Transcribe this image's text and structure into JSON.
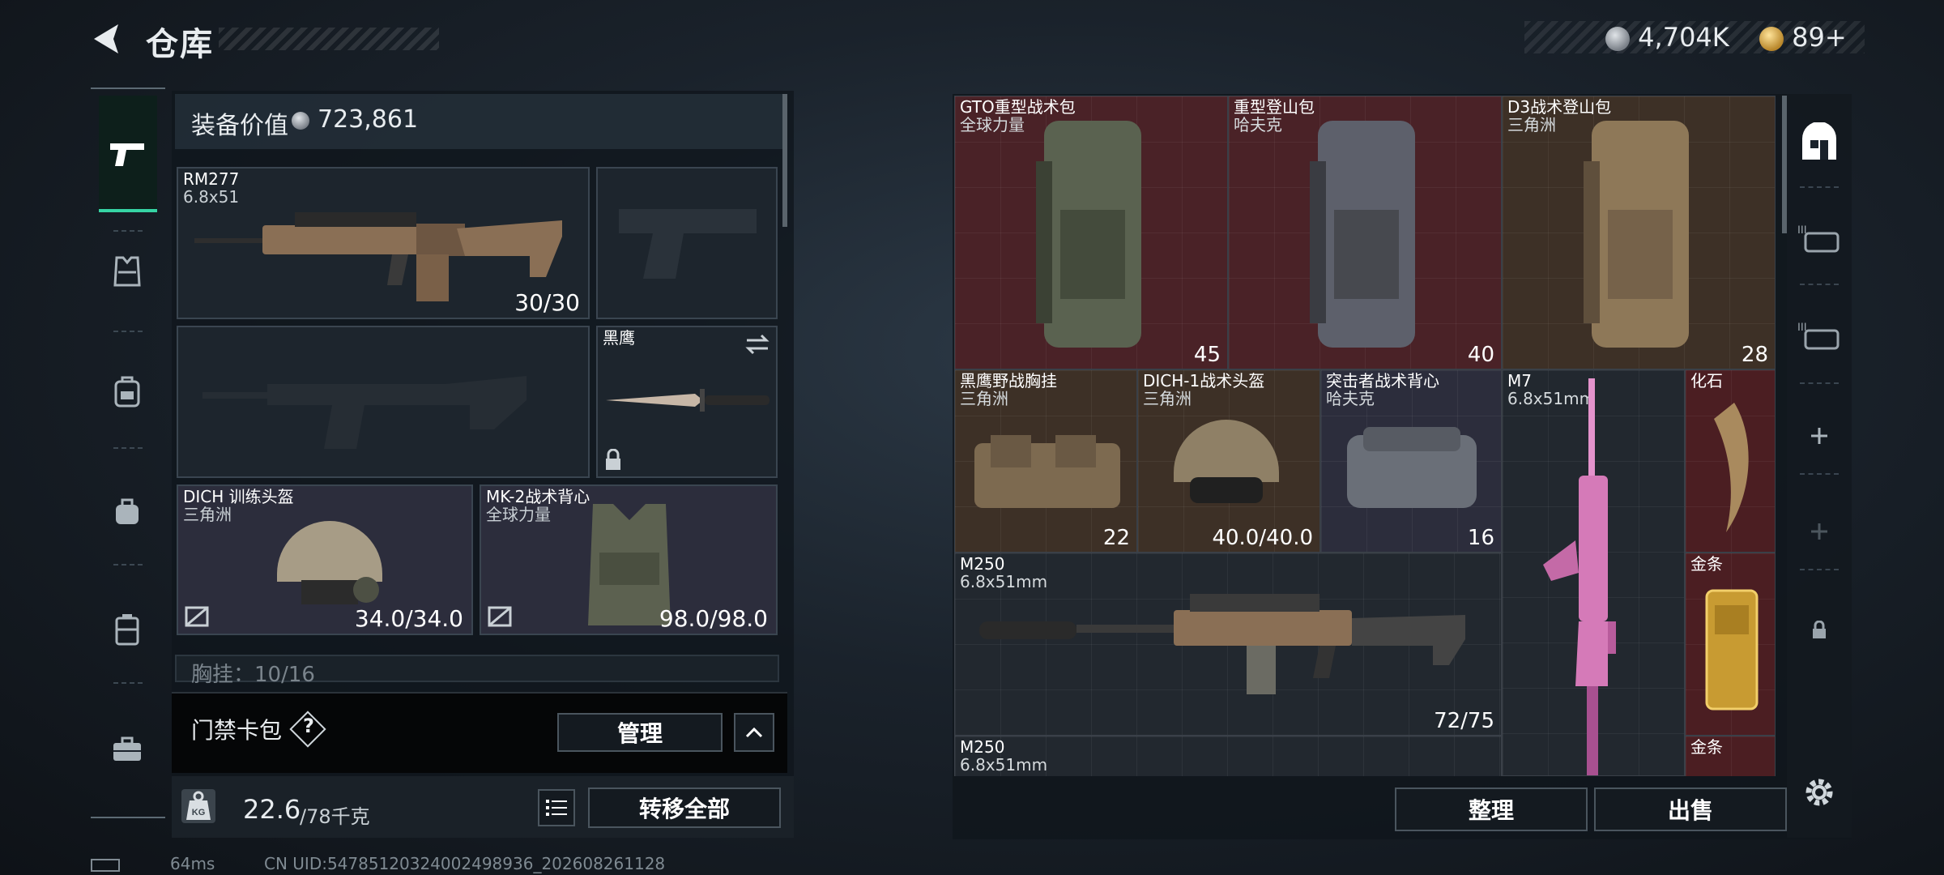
{
  "header": {
    "title": "仓库",
    "back_icon": "back-arrow-icon"
  },
  "currency": {
    "silver": "4,704K",
    "gold": "89+"
  },
  "sidebar": {
    "tabs": [
      {
        "name": "pistol-icon",
        "active": true
      },
      {
        "name": "armor-icon"
      },
      {
        "name": "backpack-icon"
      },
      {
        "name": "bag-icon"
      },
      {
        "name": "chest-rig-icon"
      },
      {
        "name": "briefcase-icon"
      }
    ]
  },
  "loadout": {
    "value_label": "装备价值",
    "value": "723,861",
    "primary": {
      "name": "RM277",
      "caliber": "6.8x51",
      "ammo": "30/30"
    },
    "melee": {
      "name": "黑鹰"
    },
    "helmet": {
      "name": "DICH 训练头盔",
      "maker": "三角洲",
      "durability": "34.0/34.0"
    },
    "armor": {
      "name": "MK-2战术背心",
      "maker": "全球力量",
      "durability": "98.0/98.0"
    },
    "chest_row": "胸挂：10/16",
    "card_label": "门禁卡包",
    "card_help": "?",
    "manage_btn": "管理",
    "weight": "22.6",
    "weight_max": "/78千克",
    "kg_label": "KG",
    "transfer_btn": "转移全部"
  },
  "stash": {
    "items": [
      {
        "name": "GTO重型战术包",
        "maker": "全球力量",
        "val": "45"
      },
      {
        "name": "重型登山包",
        "maker": "哈夫克",
        "val": "40"
      },
      {
        "name": "D3战术登山包",
        "maker": "三角洲",
        "val": "28"
      },
      {
        "name": "黑鹰野战胸挂",
        "maker": "三角洲",
        "val": "22"
      },
      {
        "name": "DICH-1战术头盔",
        "maker": "三角洲",
        "val": "40.0/40.0"
      },
      {
        "name": "突击者战术背心",
        "maker": "哈夫克",
        "val": "16"
      },
      {
        "name": "M7",
        "maker": "6.8x51mm",
        "val": ""
      },
      {
        "name": "化石",
        "maker": "",
        "val": ""
      },
      {
        "name": "M250",
        "maker": "6.8x51mm",
        "val": "72/75"
      },
      {
        "name": "金条",
        "maker": "",
        "val": ""
      },
      {
        "name": "M250",
        "maker": "6.8x51mm",
        "val": ""
      },
      {
        "name": "金条",
        "maker": "",
        "val": ""
      }
    ],
    "sort_btn": "整理",
    "sell_btn": "出售"
  },
  "right_tabs": [
    "stash-home-icon",
    "case-tier3-icon",
    "case-tier3-icon",
    "add-icon",
    "add-icon",
    "lock-icon",
    "settings-icon"
  ],
  "footer": {
    "ping": "64ms",
    "uid": "CN UID:54785120324002498936_202608261128"
  },
  "colors": {
    "accent": "#36d4a4",
    "rare_red": "#4a2227",
    "epic_purple": "#2c2d3c"
  }
}
